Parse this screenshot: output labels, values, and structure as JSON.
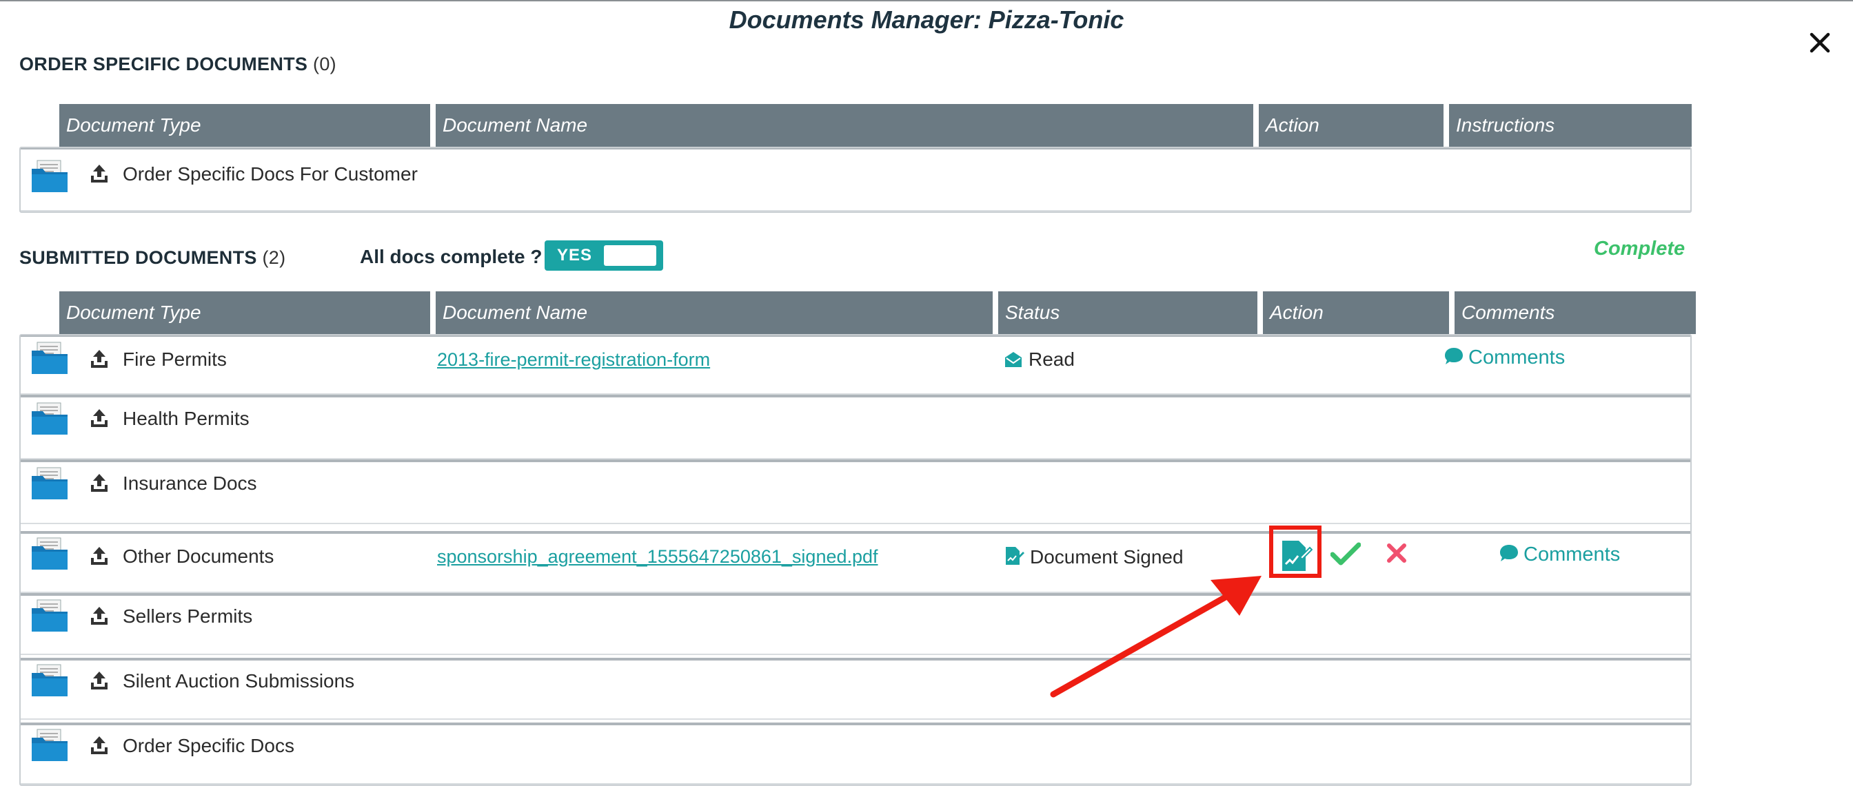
{
  "modal": {
    "title": "Documents Manager: Pizza-Tonic",
    "close_icon": "close-icon"
  },
  "order_section": {
    "title": "ORDER SPECIFIC DOCUMENTS",
    "count": "(0)",
    "headers": {
      "doc_type": "Document Type",
      "doc_name": "Document Name",
      "action": "Action",
      "instructions": "Instructions"
    },
    "rows": [
      {
        "doc_type": "Order Specific Docs For Customer"
      }
    ]
  },
  "submitted_section": {
    "title": "SUBMITTED DOCUMENTS",
    "count": "(2)",
    "all_docs_label": "All docs complete ?",
    "toggle_label": "YES",
    "toggle_state": "on",
    "complete_label": "Complete",
    "headers": {
      "doc_type": "Document Type",
      "doc_name": "Document Name",
      "status": "Status",
      "action": "Action",
      "comments": "Comments"
    },
    "rows": [
      {
        "doc_type": "Fire Permits",
        "doc_name": "2013-fire-permit-registration-form",
        "status": "Read",
        "status_icon": "envelope-open-icon",
        "comments": "Comments"
      },
      {
        "doc_type": "Health Permits"
      },
      {
        "doc_type": "Insurance Docs"
      },
      {
        "doc_type": "Other Documents",
        "doc_name": "sponsorship_agreement_1555647250861_signed.pdf",
        "status": "Document Signed",
        "status_icon": "signed-document-icon",
        "actions": [
          "sign-document-icon",
          "approve-check-icon",
          "reject-x-icon"
        ],
        "comments": "Comments"
      },
      {
        "doc_type": "Sellers Permits"
      },
      {
        "doc_type": "Silent Auction Submissions"
      },
      {
        "doc_type": "Order Specific Docs"
      }
    ]
  },
  "colors": {
    "header_bg": "#6b7a83",
    "teal": "#1aa4a4",
    "folder_blue": "#1b8fd1",
    "complete_green": "#3cc16b",
    "reject_red": "#f0506e",
    "annotation_red": "#ee1d12"
  }
}
